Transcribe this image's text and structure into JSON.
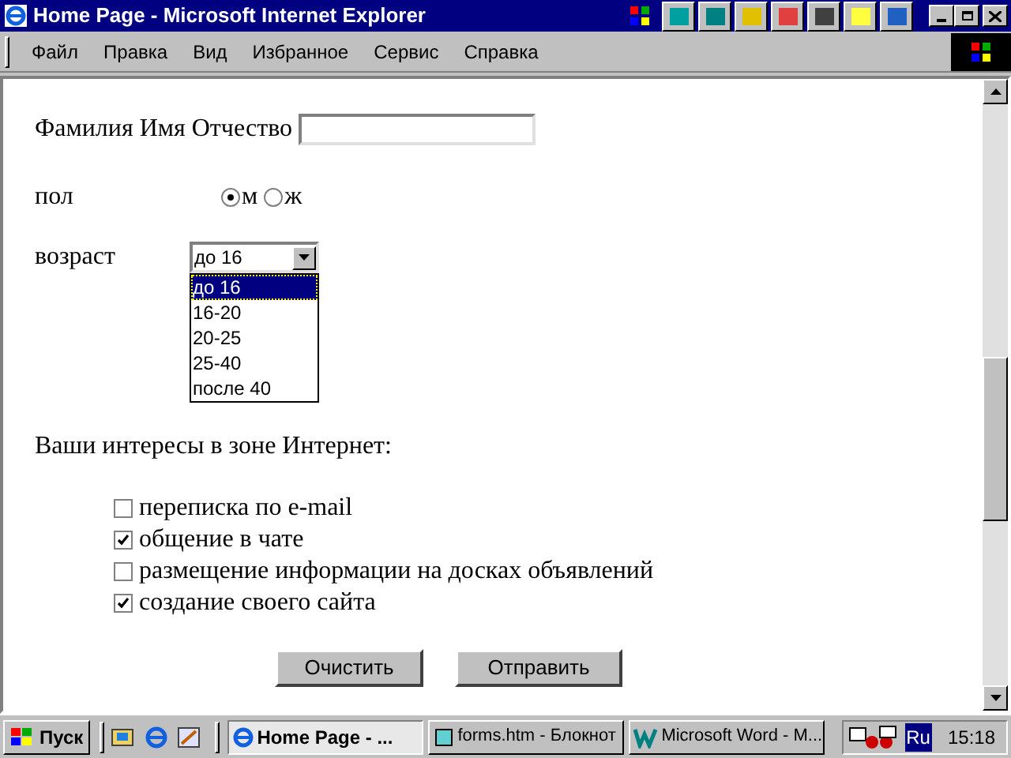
{
  "window": {
    "title": "Home Page - Microsoft Internet Explorer"
  },
  "menu": [
    "Файл",
    "Правка",
    "Вид",
    "Избранное",
    "Сервис",
    "Справка"
  ],
  "form": {
    "name_label": "Фамилия Имя Отчество",
    "gender_label": "пол",
    "gender_options": [
      {
        "label": "м",
        "selected": true
      },
      {
        "label": "ж",
        "selected": false
      }
    ],
    "age_label": "возраст",
    "age_value": "до 16",
    "age_dropdown_expanded": true,
    "age_options": [
      {
        "label": "до 16",
        "selected": true
      },
      {
        "label": "16-20",
        "selected": false
      },
      {
        "label": "20-25",
        "selected": false
      },
      {
        "label": "25-40",
        "selected": false
      },
      {
        "label": "после 40",
        "selected": false
      }
    ],
    "interests_heading": "Ваши интересы в зоне Интернет:",
    "interests": [
      {
        "label": "переписка по e-mail",
        "checked": false
      },
      {
        "label": "общение в чате",
        "checked": true
      },
      {
        "label": "размещение информации на досках объявлений",
        "checked": false
      },
      {
        "label": "создание своего сайта",
        "checked": true
      }
    ],
    "buttons": [
      "Очистить",
      "Отправить"
    ]
  },
  "taskbar": {
    "start": "Пуск",
    "tasks": [
      {
        "label": "Home Page - ...",
        "selected": true,
        "kind": "browser"
      },
      {
        "label": "forms.htm - Блокнот",
        "selected": false,
        "kind": "notepad"
      },
      {
        "label": "Microsoft Word - M...",
        "selected": false,
        "kind": "word"
      }
    ],
    "language": "Ru",
    "clock": "15:18"
  }
}
